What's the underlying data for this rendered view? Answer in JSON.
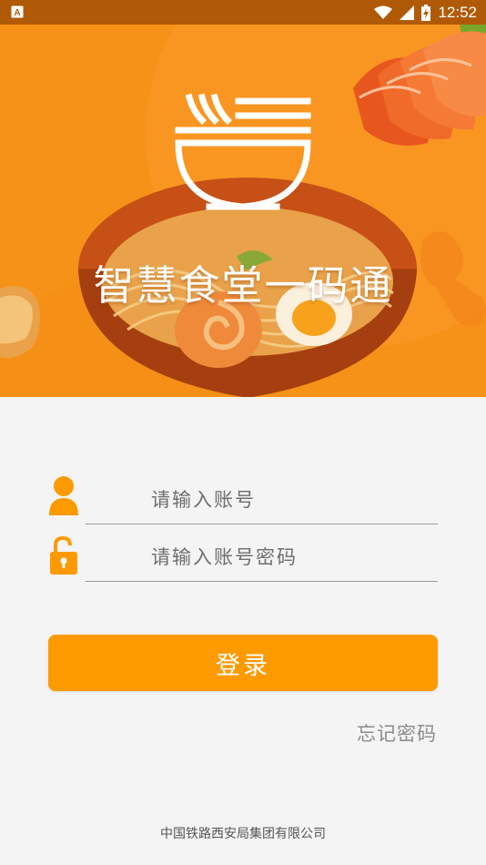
{
  "status_bar": {
    "time": "12:52",
    "icons": [
      "notification-a-icon",
      "wifi-icon",
      "cell-signal-icon",
      "battery-charging-icon"
    ]
  },
  "hero": {
    "title": "智慧食堂一码通"
  },
  "form": {
    "account_placeholder": "请输入账号",
    "password_placeholder": "请输入账号密码",
    "login_label": "登录",
    "forgot_label": "忘记密码"
  },
  "footer": {
    "company": "中国铁路西安局集团有限公司"
  },
  "colors": {
    "accent": "#fd9a00",
    "hero_bg": "#f79219",
    "status_bar": "#b05a07"
  }
}
